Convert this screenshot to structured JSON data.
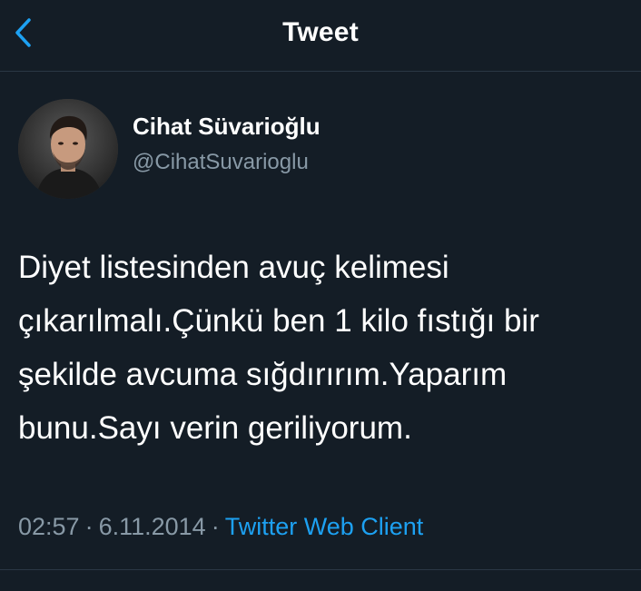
{
  "nav": {
    "title": "Tweet",
    "back_icon": "chevron-left-icon"
  },
  "author": {
    "display_name": "Cihat Süvarioğlu",
    "handle": "@CihatSuvarioglu"
  },
  "tweet": {
    "lines": [
      "Diyet listesinden avuç kelimesi",
      "çıkarılmalı.Çünkü ben 1 kilo fıstığı bir",
      "şekilde avcuma sığdırırım.Yaparım",
      "bunu.Sayı verin geriliyorum."
    ]
  },
  "meta": {
    "time": "02:57",
    "separator": "·",
    "date": "6.11.2014",
    "source": "Twitter Web Client"
  },
  "colors": {
    "background": "#141d26",
    "accent": "#1da1f2",
    "secondary_text": "#8899a6",
    "divider": "#2a3744"
  }
}
